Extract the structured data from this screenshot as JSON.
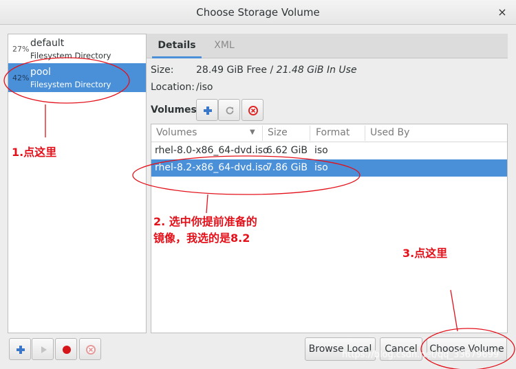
{
  "window": {
    "title": "Choose Storage Volume",
    "close_glyph": "×"
  },
  "pools": [
    {
      "percent": "27%",
      "name": "default",
      "type": "Filesystem Directory",
      "selected": false
    },
    {
      "percent": "42%",
      "name": "pool",
      "type": "Filesystem Directory",
      "selected": true
    }
  ],
  "tabs": [
    {
      "label": "Details",
      "active": true
    },
    {
      "label": "XML",
      "active": false
    }
  ],
  "details": {
    "size_label": "Size:",
    "size_free": "28.49 GiB Free / ",
    "size_used": "21.48 GiB In Use",
    "location_label": "Location:",
    "location_value": "/iso",
    "volumes_label": "Volumes"
  },
  "table": {
    "columns": [
      "Volumes",
      "Size",
      "Format",
      "Used By"
    ],
    "rows": [
      {
        "name": "rhel-8.0-x86_64-dvd.iso",
        "size": "6.62 GiB",
        "format": "iso",
        "used_by": "",
        "selected": false
      },
      {
        "name": "rhel-8.2-x86_64-dvd.iso",
        "size": "7.86 GiB",
        "format": "iso",
        "used_by": "",
        "selected": true
      }
    ]
  },
  "buttons": {
    "browse_local": "Browse Local",
    "cancel": "Cancel",
    "choose_volume": "Choose Volume"
  },
  "annotations": {
    "step1": "1.点这里",
    "step2_line1": "2. 选中你提前准备的",
    "step2_line2": "镜像，我选的是8.2",
    "step3": "3.点这里",
    "color": "#e3101a"
  },
  "watermark": "https://blog.csdn.net/qq_33679699",
  "colors": {
    "selection": "#4a90d9",
    "annotation": "#e3101a"
  }
}
